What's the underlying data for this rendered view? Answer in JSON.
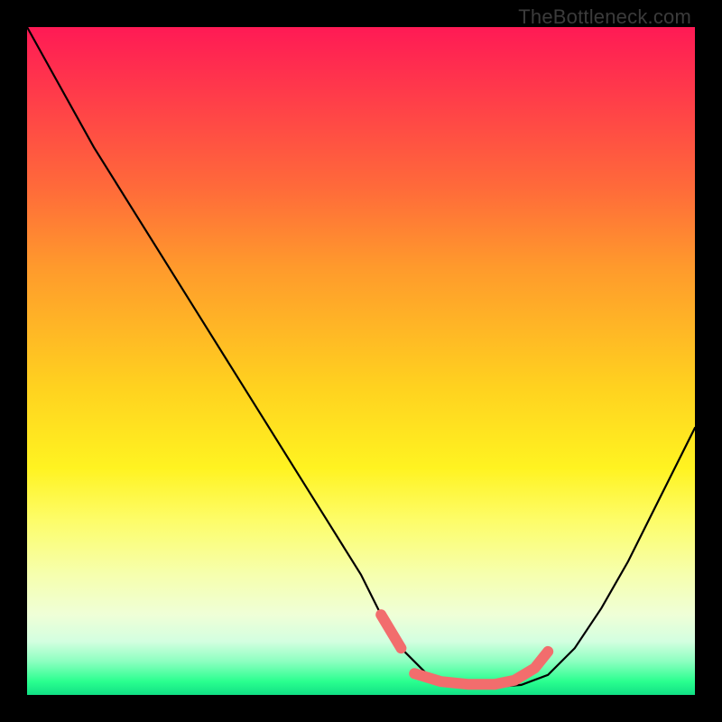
{
  "watermark": "TheBottleneck.com",
  "colors": {
    "frame_bg": "#000000",
    "curve_stroke": "#000000",
    "highlight": "#f26d6d",
    "gradient_top": "#ff1a55",
    "gradient_bottom": "#11e085"
  },
  "chart_data": {
    "type": "line",
    "title": "",
    "xlabel": "",
    "ylabel": "",
    "xlim": [
      0,
      100
    ],
    "ylim": [
      0,
      100
    ],
    "grid": false,
    "legend": false,
    "series": [
      {
        "name": "bottleneck-curve",
        "x": [
          0,
          5,
          10,
          15,
          20,
          25,
          30,
          35,
          40,
          45,
          50,
          53,
          56,
          60,
          64,
          68,
          70,
          74,
          78,
          82,
          86,
          90,
          94,
          98,
          100
        ],
        "values": [
          100,
          91,
          82,
          74,
          66,
          58,
          50,
          42,
          34,
          26,
          18,
          12,
          7,
          3,
          1.5,
          1.2,
          1.2,
          1.5,
          3,
          7,
          13,
          20,
          28,
          36,
          40
        ]
      }
    ],
    "highlight_segments": [
      {
        "name": "left-shoulder",
        "x": [
          53,
          56
        ],
        "values": [
          12,
          7
        ]
      },
      {
        "name": "valley-floor",
        "x": [
          58,
          62,
          66,
          70
        ],
        "values": [
          3.2,
          2.0,
          1.6,
          1.6
        ]
      },
      {
        "name": "right-shoulder",
        "x": [
          70,
          73,
          76,
          78
        ],
        "values": [
          1.6,
          2.2,
          4.0,
          6.5
        ]
      }
    ]
  }
}
